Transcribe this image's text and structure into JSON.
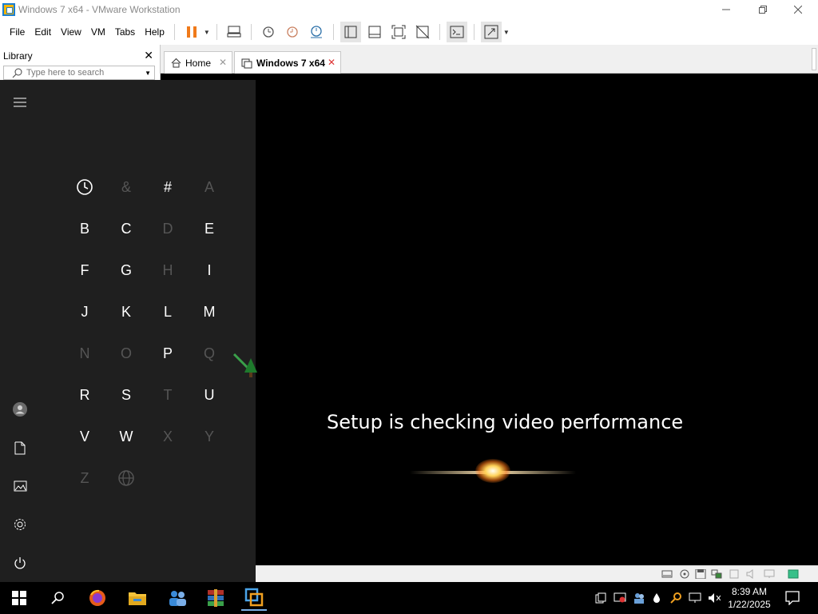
{
  "window": {
    "title": "Windows 7 x64 - VMware Workstation"
  },
  "menu": {
    "items": [
      "File",
      "Edit",
      "View",
      "VM",
      "Tabs",
      "Help"
    ]
  },
  "library": {
    "title": "Library",
    "search_placeholder": "Type here to search"
  },
  "tabs": [
    {
      "label": "Home",
      "active": false
    },
    {
      "label": "Windows 7 x64",
      "active": true
    }
  ],
  "guest": {
    "setup_text": "Setup is checking video performance"
  },
  "start_menu": {
    "letters": [
      {
        "char": "clock",
        "enabled": true
      },
      {
        "char": "&",
        "enabled": false
      },
      {
        "char": "#",
        "enabled": true
      },
      {
        "char": "A",
        "enabled": false
      },
      {
        "char": "B",
        "enabled": true
      },
      {
        "char": "C",
        "enabled": true
      },
      {
        "char": "D",
        "enabled": false
      },
      {
        "char": "E",
        "enabled": true
      },
      {
        "char": "F",
        "enabled": true
      },
      {
        "char": "G",
        "enabled": true
      },
      {
        "char": "H",
        "enabled": false
      },
      {
        "char": "I",
        "enabled": true
      },
      {
        "char": "J",
        "enabled": true
      },
      {
        "char": "K",
        "enabled": true
      },
      {
        "char": "L",
        "enabled": true
      },
      {
        "char": "M",
        "enabled": true
      },
      {
        "char": "N",
        "enabled": false
      },
      {
        "char": "O",
        "enabled": false
      },
      {
        "char": "P",
        "enabled": true
      },
      {
        "char": "Q",
        "enabled": false
      },
      {
        "char": "R",
        "enabled": true
      },
      {
        "char": "S",
        "enabled": true
      },
      {
        "char": "T",
        "enabled": false
      },
      {
        "char": "U",
        "enabled": true
      },
      {
        "char": "V",
        "enabled": true
      },
      {
        "char": "W",
        "enabled": true
      },
      {
        "char": "X",
        "enabled": false
      },
      {
        "char": "Y",
        "enabled": false
      },
      {
        "char": "Z",
        "enabled": false
      },
      {
        "char": "globe",
        "enabled": false
      }
    ]
  },
  "taskbar": {
    "clock_time": "8:39 AM",
    "clock_date": "1/22/2025"
  },
  "colors": {
    "start_bg": "#1f1f1f",
    "accent_blue": "#1a7fd4",
    "pause_orange": "#f07a1a"
  }
}
